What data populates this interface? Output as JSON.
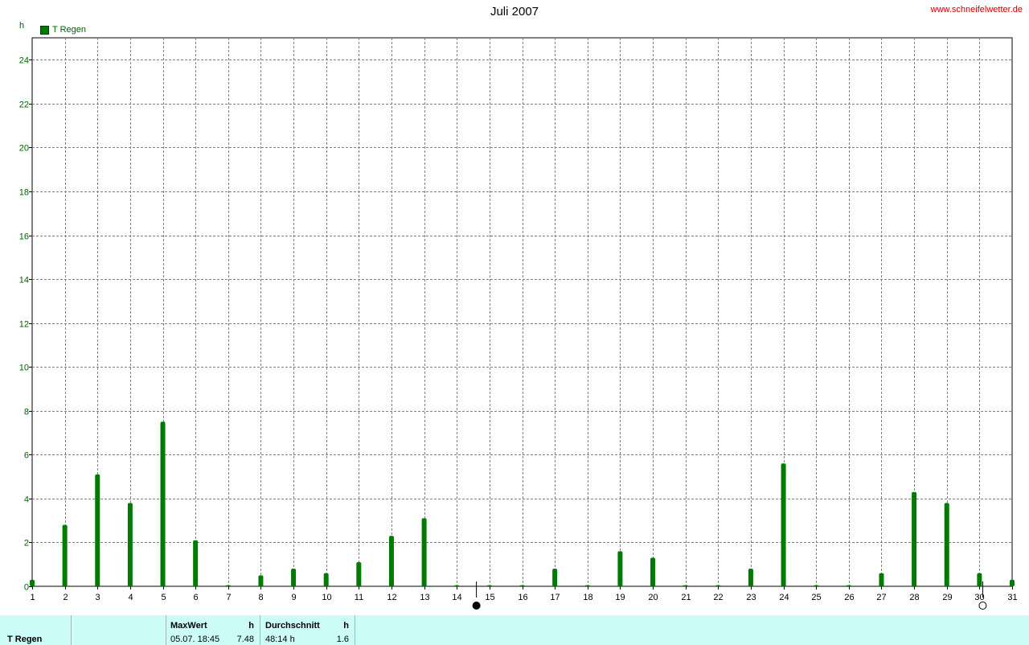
{
  "header": {
    "title": "Juli 2007",
    "website": "www.schneifelwetter.de",
    "unit": "h",
    "legend": "T Regen"
  },
  "colors": {
    "bar": "#007a00",
    "bar_dark": "#004d00",
    "grid": "#808080"
  },
  "chart_data": {
    "type": "bar",
    "title": "Juli 2007",
    "ylabel": "h",
    "xlim": [
      1,
      31
    ],
    "ylim": [
      0,
      25
    ],
    "yticks": [
      0,
      2,
      4,
      6,
      8,
      10,
      12,
      14,
      16,
      18,
      20,
      22,
      24
    ],
    "xticks": [
      1,
      2,
      3,
      4,
      5,
      6,
      7,
      8,
      9,
      10,
      11,
      12,
      13,
      14,
      15,
      16,
      17,
      18,
      19,
      20,
      21,
      22,
      23,
      24,
      25,
      26,
      27,
      28,
      29,
      30,
      31
    ],
    "grid": true,
    "legend_position": "top-left",
    "series": [
      {
        "name": "T Regen",
        "x": [
          1,
          2,
          3,
          4,
          5,
          6,
          7,
          8,
          9,
          10,
          11,
          12,
          13,
          14,
          15,
          16,
          17,
          18,
          19,
          20,
          21,
          22,
          23,
          24,
          25,
          26,
          27,
          28,
          29,
          30,
          31
        ],
        "values": [
          0.3,
          2.8,
          5.1,
          3.8,
          7.5,
          2.1,
          0.05,
          0.5,
          0.8,
          0.6,
          1.1,
          2.3,
          3.1,
          0.05,
          0.05,
          0.05,
          0.8,
          0.05,
          1.6,
          1.3,
          0.05,
          0.05,
          0.8,
          5.6,
          0.05,
          0.05,
          0.6,
          4.3,
          3.8,
          0.6,
          0.3
        ]
      }
    ],
    "moon_phases": [
      {
        "x": 14.6,
        "phase": "new"
      },
      {
        "x": 30.1,
        "phase": "full"
      }
    ]
  },
  "stats": {
    "series_label": "T Regen",
    "max_header": "MaxWert",
    "max_unit": "h",
    "max_date": "05.07.  18:45",
    "max_value": "7.48",
    "avg_header": "Durchschnitt",
    "avg_unit": "h",
    "avg_total": "48:14 h",
    "avg_value": "1.6"
  }
}
